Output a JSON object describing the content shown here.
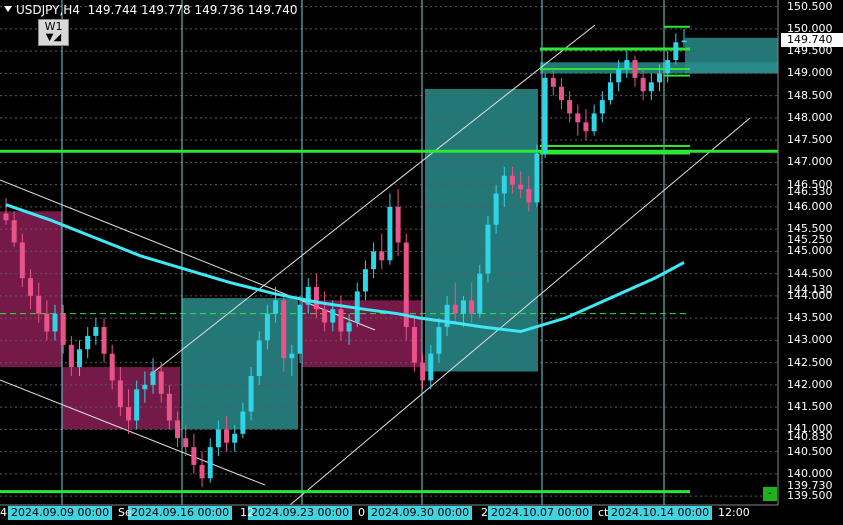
{
  "header": {
    "symbol": "USDJPY,H4",
    "ohlc": "149.744 149.778 149.736 149.740"
  },
  "timeframe_button": {
    "label": "W1"
  },
  "colors": {
    "background": "#000000",
    "bull": "#2fd5e6",
    "bear": "#e8538a",
    "ma": "#3ee8f5",
    "hline": "#2ae832",
    "period_sep": "#67d8e0",
    "zone_teal": "#2a8c8c",
    "zone_magenta": "#8a1f55"
  },
  "price_axis": {
    "labels": [
      "150.500",
      "150.000",
      "149.500",
      "149.000",
      "148.500",
      "148.000",
      "147.500",
      "147.000",
      "146.500",
      "146.000",
      "145.500",
      "145.000",
      "144.500",
      "144.000",
      "143.500",
      "143.000",
      "142.500",
      "142.000",
      "141.500",
      "141.000",
      "140.500",
      "140.000",
      "139.500"
    ],
    "small_labels": [
      "146.330",
      "145.250",
      "144.130",
      "140.830",
      "139.730"
    ],
    "current_price_label": "149.740",
    "range": [
      139.3,
      150.65
    ]
  },
  "time_axis": {
    "labels": [
      "2024.09.09 00:00",
      "2024.09.16 00:00",
      "2024.09.23 00:00",
      "2024.09.30 00:00",
      "2024.10.07 00:00",
      "2024.10.14 00:00"
    ],
    "fragments": [
      "4",
      "Se",
      "12",
      "0",
      "2",
      "ct",
      "12:00"
    ]
  },
  "chart_data": {
    "type": "candlestick",
    "symbol": "USDJPY",
    "timeframe": "H4",
    "y_range": [
      139.3,
      150.65
    ],
    "moving_average": [
      [
        0,
        146.05
      ],
      [
        20,
        145.7
      ],
      [
        40,
        145.3
      ],
      [
        60,
        144.9
      ],
      [
        80,
        144.6
      ],
      [
        100,
        144.3
      ],
      [
        120,
        144.05
      ],
      [
        140,
        143.85
      ],
      [
        160,
        143.7
      ],
      [
        175,
        143.6
      ],
      [
        185,
        143.5
      ],
      [
        200,
        143.4
      ],
      [
        213,
        143.3
      ],
      [
        230,
        143.2
      ],
      [
        250,
        143.5
      ],
      [
        270,
        143.95
      ],
      [
        290,
        144.4
      ],
      [
        303,
        144.75
      ]
    ],
    "horizontal_lines": [
      147.25,
      143.6,
      139.6,
      149.55,
      149.1,
      147.35,
      147.25
    ],
    "candles": [
      {
        "o": 145.85,
        "h": 146.2,
        "l": 145.6,
        "c": 145.7
      },
      {
        "o": 145.7,
        "h": 145.9,
        "l": 145.1,
        "c": 145.2
      },
      {
        "o": 145.2,
        "h": 145.4,
        "l": 144.2,
        "c": 144.4
      },
      {
        "o": 144.4,
        "h": 144.6,
        "l": 143.7,
        "c": 144.0
      },
      {
        "o": 144.0,
        "h": 144.3,
        "l": 143.4,
        "c": 143.6
      },
      {
        "o": 143.6,
        "h": 143.9,
        "l": 143.0,
        "c": 143.2
      },
      {
        "o": 143.2,
        "h": 143.8,
        "l": 143.0,
        "c": 143.6
      },
      {
        "o": 143.6,
        "h": 143.8,
        "l": 142.7,
        "c": 142.9
      },
      {
        "o": 142.9,
        "h": 143.1,
        "l": 142.2,
        "c": 142.4
      },
      {
        "o": 142.4,
        "h": 143.0,
        "l": 142.2,
        "c": 142.8
      },
      {
        "o": 142.8,
        "h": 143.3,
        "l": 142.6,
        "c": 143.1
      },
      {
        "o": 143.1,
        "h": 143.5,
        "l": 142.9,
        "c": 143.3
      },
      {
        "o": 143.3,
        "h": 143.5,
        "l": 142.5,
        "c": 142.7
      },
      {
        "o": 142.7,
        "h": 142.9,
        "l": 141.9,
        "c": 142.1
      },
      {
        "o": 142.1,
        "h": 142.4,
        "l": 141.3,
        "c": 141.5
      },
      {
        "o": 141.5,
        "h": 141.9,
        "l": 140.9,
        "c": 141.2
      },
      {
        "o": 141.2,
        "h": 142.1,
        "l": 141.0,
        "c": 141.9
      },
      {
        "o": 141.9,
        "h": 142.3,
        "l": 141.6,
        "c": 142.0
      },
      {
        "o": 142.0,
        "h": 142.6,
        "l": 141.8,
        "c": 142.3
      },
      {
        "o": 142.3,
        "h": 142.5,
        "l": 141.6,
        "c": 141.8
      },
      {
        "o": 141.8,
        "h": 142.0,
        "l": 141.0,
        "c": 141.2
      },
      {
        "o": 141.2,
        "h": 141.4,
        "l": 140.6,
        "c": 140.8
      },
      {
        "o": 140.8,
        "h": 141.1,
        "l": 140.4,
        "c": 140.6
      },
      {
        "o": 140.6,
        "h": 140.9,
        "l": 140.0,
        "c": 140.2
      },
      {
        "o": 140.2,
        "h": 140.5,
        "l": 139.7,
        "c": 139.9
      },
      {
        "o": 139.9,
        "h": 140.8,
        "l": 139.8,
        "c": 140.6
      },
      {
        "o": 140.6,
        "h": 141.2,
        "l": 140.4,
        "c": 141.0
      },
      {
        "o": 141.0,
        "h": 141.3,
        "l": 140.5,
        "c": 140.7
      },
      {
        "o": 140.7,
        "h": 141.1,
        "l": 140.5,
        "c": 140.9
      },
      {
        "o": 140.9,
        "h": 141.6,
        "l": 140.8,
        "c": 141.4
      },
      {
        "o": 141.4,
        "h": 142.4,
        "l": 141.2,
        "c": 142.2
      },
      {
        "o": 142.2,
        "h": 143.2,
        "l": 142.0,
        "c": 143.0
      },
      {
        "o": 143.0,
        "h": 143.8,
        "l": 142.8,
        "c": 143.6
      },
      {
        "o": 143.6,
        "h": 144.2,
        "l": 143.4,
        "c": 143.9
      },
      {
        "o": 143.9,
        "h": 144.0,
        "l": 142.3,
        "c": 142.6
      },
      {
        "o": 142.6,
        "h": 142.9,
        "l": 142.2,
        "c": 142.7
      },
      {
        "o": 142.7,
        "h": 144.0,
        "l": 142.5,
        "c": 143.8
      },
      {
        "o": 143.8,
        "h": 144.4,
        "l": 143.6,
        "c": 144.2
      },
      {
        "o": 144.2,
        "h": 144.5,
        "l": 143.5,
        "c": 143.7
      },
      {
        "o": 143.7,
        "h": 144.1,
        "l": 143.2,
        "c": 143.4
      },
      {
        "o": 143.4,
        "h": 143.9,
        "l": 143.2,
        "c": 143.7
      },
      {
        "o": 143.7,
        "h": 144.0,
        "l": 143.0,
        "c": 143.2
      },
      {
        "o": 143.2,
        "h": 143.6,
        "l": 142.9,
        "c": 143.4
      },
      {
        "o": 143.4,
        "h": 144.3,
        "l": 143.3,
        "c": 144.1
      },
      {
        "o": 144.1,
        "h": 144.8,
        "l": 143.9,
        "c": 144.6
      },
      {
        "o": 144.6,
        "h": 145.2,
        "l": 144.4,
        "c": 145.0
      },
      {
        "o": 145.0,
        "h": 145.4,
        "l": 144.6,
        "c": 144.8
      },
      {
        "o": 144.8,
        "h": 146.3,
        "l": 144.7,
        "c": 146.0
      },
      {
        "o": 146.0,
        "h": 146.4,
        "l": 144.9,
        "c": 145.2
      },
      {
        "o": 145.2,
        "h": 145.4,
        "l": 143.0,
        "c": 143.3
      },
      {
        "o": 143.3,
        "h": 143.5,
        "l": 142.3,
        "c": 142.5
      },
      {
        "o": 142.5,
        "h": 142.7,
        "l": 141.9,
        "c": 142.1
      },
      {
        "o": 142.1,
        "h": 142.9,
        "l": 141.9,
        "c": 142.7
      },
      {
        "o": 142.7,
        "h": 143.5,
        "l": 142.5,
        "c": 143.3
      },
      {
        "o": 143.3,
        "h": 144.0,
        "l": 143.1,
        "c": 143.8
      },
      {
        "o": 143.8,
        "h": 144.3,
        "l": 143.4,
        "c": 143.6
      },
      {
        "o": 143.6,
        "h": 144.0,
        "l": 143.3,
        "c": 143.9
      },
      {
        "o": 143.9,
        "h": 144.3,
        "l": 143.4,
        "c": 143.6
      },
      {
        "o": 143.6,
        "h": 144.7,
        "l": 143.5,
        "c": 144.5
      },
      {
        "o": 144.5,
        "h": 145.8,
        "l": 144.3,
        "c": 145.6
      },
      {
        "o": 145.6,
        "h": 146.5,
        "l": 145.4,
        "c": 146.3
      },
      {
        "o": 146.3,
        "h": 146.9,
        "l": 146.0,
        "c": 146.7
      },
      {
        "o": 146.7,
        "h": 146.9,
        "l": 146.3,
        "c": 146.5
      },
      {
        "o": 146.5,
        "h": 146.8,
        "l": 146.2,
        "c": 146.4
      },
      {
        "o": 146.4,
        "h": 146.7,
        "l": 145.9,
        "c": 146.1
      },
      {
        "o": 146.1,
        "h": 147.4,
        "l": 146.0,
        "c": 147.2
      },
      {
        "o": 147.2,
        "h": 149.0,
        "l": 147.1,
        "c": 148.9
      },
      {
        "o": 148.9,
        "h": 149.1,
        "l": 148.5,
        "c": 148.7
      },
      {
        "o": 148.7,
        "h": 148.9,
        "l": 148.2,
        "c": 148.4
      },
      {
        "o": 148.4,
        "h": 148.6,
        "l": 147.9,
        "c": 148.1
      },
      {
        "o": 148.1,
        "h": 148.3,
        "l": 147.6,
        "c": 147.9
      },
      {
        "o": 147.9,
        "h": 148.2,
        "l": 147.5,
        "c": 147.7
      },
      {
        "o": 147.7,
        "h": 148.3,
        "l": 147.6,
        "c": 148.1
      },
      {
        "o": 148.1,
        "h": 148.6,
        "l": 147.9,
        "c": 148.4
      },
      {
        "o": 148.4,
        "h": 149.0,
        "l": 148.3,
        "c": 148.8
      },
      {
        "o": 148.8,
        "h": 149.3,
        "l": 148.6,
        "c": 149.1
      },
      {
        "o": 149.1,
        "h": 149.5,
        "l": 148.9,
        "c": 149.3
      },
      {
        "o": 149.3,
        "h": 149.4,
        "l": 148.7,
        "c": 148.9
      },
      {
        "o": 148.9,
        "h": 149.1,
        "l": 148.4,
        "c": 148.6
      },
      {
        "o": 148.6,
        "h": 149.0,
        "l": 148.4,
        "c": 148.8
      },
      {
        "o": 148.8,
        "h": 149.2,
        "l": 148.6,
        "c": 149.0
      },
      {
        "o": 149.0,
        "h": 149.5,
        "l": 148.8,
        "c": 149.3
      },
      {
        "o": 149.3,
        "h": 149.9,
        "l": 149.2,
        "c": 149.7
      },
      {
        "o": 149.7,
        "h": 150.0,
        "l": 149.6,
        "c": 149.74
      }
    ]
  }
}
